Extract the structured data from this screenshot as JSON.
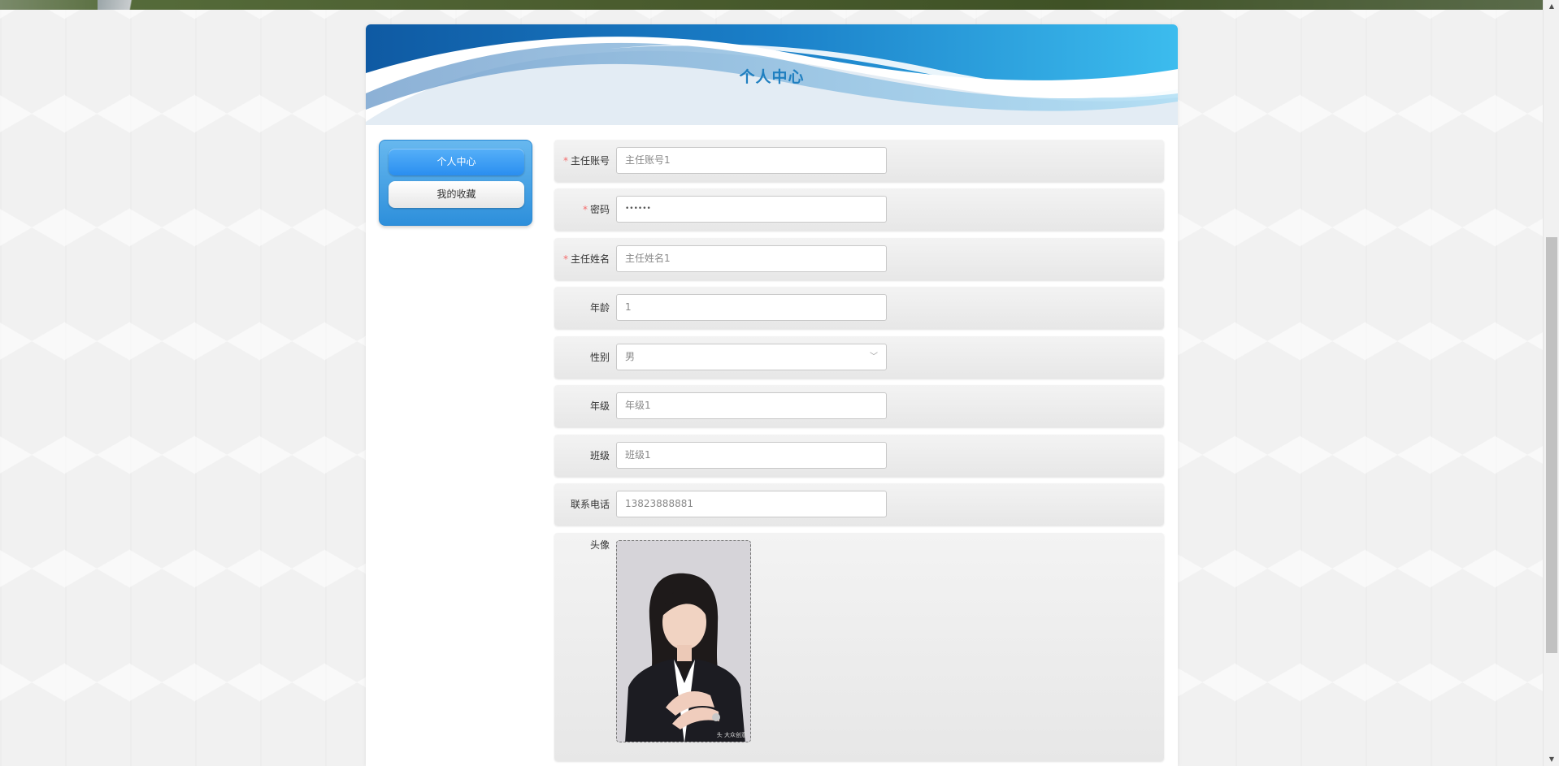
{
  "page": {
    "title": "个人中心"
  },
  "menu": {
    "items": [
      {
        "label": "个人中心",
        "active": true
      },
      {
        "label": "我的收藏",
        "active": false
      }
    ]
  },
  "form": {
    "account": {
      "label": "主任账号",
      "required": true,
      "value": "主任账号1"
    },
    "password": {
      "label": "密码",
      "required": true,
      "value": "••••••"
    },
    "name": {
      "label": "主任姓名",
      "required": true,
      "value": "主任姓名1"
    },
    "age": {
      "label": "年龄",
      "required": false,
      "value": "1"
    },
    "gender": {
      "label": "性别",
      "required": false,
      "value": "男"
    },
    "grade": {
      "label": "年级",
      "required": false,
      "value": "年级1"
    },
    "class": {
      "label": "班级",
      "required": false,
      "value": "班级1"
    },
    "phone": {
      "label": "联系电话",
      "required": false,
      "value": "13823888881"
    },
    "avatar": {
      "label": "头像",
      "watermark": "头 大众创意"
    }
  },
  "icons": {
    "select": "chevron-down-icon",
    "scroll_up": "triangle-up-icon",
    "scroll_down": "triangle-down-icon"
  },
  "colors": {
    "title": "#1f7fc0",
    "menu_active": "#2a8ef0",
    "required": "#f56c6c"
  }
}
